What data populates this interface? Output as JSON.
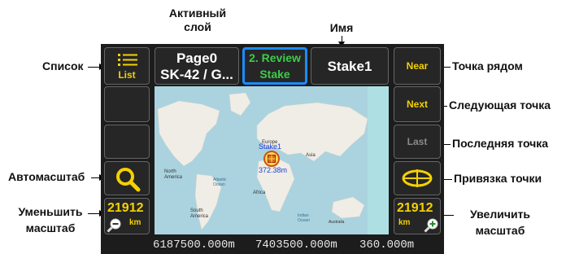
{
  "annotations": {
    "active_layer": "Активный\nслой",
    "name": "Имя",
    "list": "Список",
    "near_point": "Точка рядом",
    "next_point": "Следующая точка",
    "last_point": "Последняя точка",
    "autoscale": "Автомасштаб",
    "zoom_out": "Уменьшить\nмасштаб",
    "snap_point": "Привязка точки",
    "zoom_in": "Увеличить\nмасштаб"
  },
  "toolbar": {
    "list_label": "List",
    "layer_line1": "Page0",
    "layer_line2": "SK-42 / G...",
    "review_line1": "2. Review",
    "review_line2": "Stake",
    "object_name": "Stake1",
    "near_label": "Near",
    "next_label": "Next",
    "last_label": "Last"
  },
  "scale": {
    "left_value": "21912",
    "left_unit": "km",
    "right_value": "21912",
    "right_unit": "km"
  },
  "map": {
    "marker_name": "Stake1",
    "marker_distance": "372.38m",
    "labels": {
      "north_america": "North\nAmerica",
      "south_america": "South\nAmerica",
      "europe": "Europe",
      "asia": "Asia",
      "africa": "Africa",
      "atlantic": "Atlantic\nOcean",
      "indian": "Indian\nOcean",
      "australia": "Australia"
    }
  },
  "status": {
    "coord_x": "6187500.000m",
    "coord_y": "7403500.000m",
    "heading": "360.000m"
  },
  "colors": {
    "accent_yellow": "#f5d100",
    "accent_blue": "#1a8cff",
    "map_water": "#aad3df",
    "map_land": "#f0ede6"
  }
}
